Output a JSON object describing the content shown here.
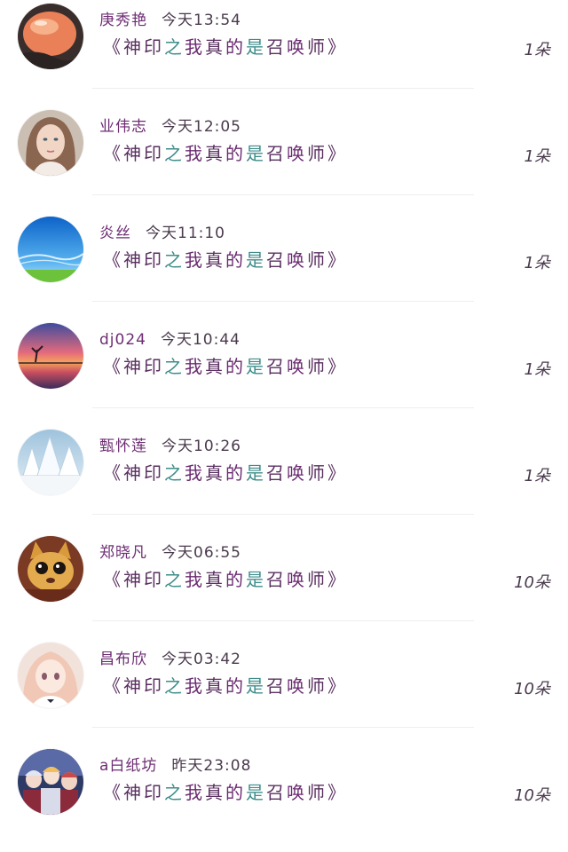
{
  "items": [
    {
      "user": "庚秀艳",
      "time": "今天13:54",
      "book": "《神印之我真的是召唤师》",
      "count": "1朵",
      "avatar": "peach-blob-photo"
    },
    {
      "user": "业伟志",
      "time": "今天12:05",
      "book": "《神印之我真的是召唤师》",
      "count": "1朵",
      "avatar": "girl-portrait-photo"
    },
    {
      "user": "炎丝",
      "time": "今天11:10",
      "book": "《神印之我真的是召唤师》",
      "count": "1朵",
      "avatar": "blue-sky-photo"
    },
    {
      "user": "dj024",
      "time": "今天10:44",
      "book": "《神印之我真的是召唤师》",
      "count": "1朵",
      "avatar": "sunset-tree-photo"
    },
    {
      "user": "甄怀莲",
      "time": "今天10:26",
      "book": "《神印之我真的是召唤师》",
      "count": "1朵",
      "avatar": "snow-forest-photo"
    },
    {
      "user": "郑晓凡",
      "time": "今天06:55",
      "book": "《神印之我真的是召唤师》",
      "count": "10朵",
      "avatar": "cartoon-cat-image"
    },
    {
      "user": "昌布欣",
      "time": "今天03:42",
      "book": "《神印之我真的是召唤师》",
      "count": "10朵",
      "avatar": "anime-girl-image"
    },
    {
      "user": "a白纸坊",
      "time": "昨天23:08",
      "book": "《神印之我真的是召唤师》",
      "count": "10朵",
      "avatar": "anime-group-image"
    }
  ]
}
